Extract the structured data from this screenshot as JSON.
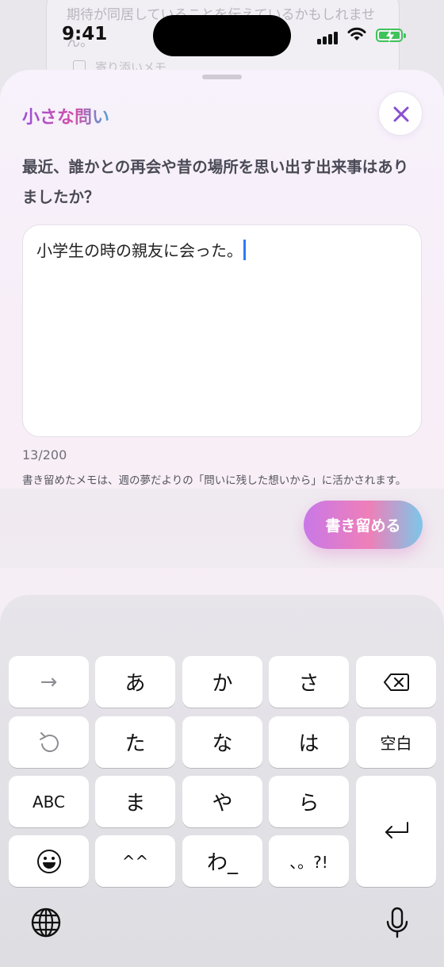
{
  "background": {
    "text": "期待が同居していることを伝えているかもしれません。",
    "memo_label": "寄り添いメモ"
  },
  "status_bar": {
    "time": "9:41",
    "battery_level": 1.0
  },
  "sheet": {
    "title": "小さな問い",
    "question": "最近、誰かとの再会や昔の場所を思い出す出来事はありましたか？",
    "answer_value": "小学生の時の親友に会った。",
    "char_count": "13/200",
    "note": "書き留めたメモは、週の夢だよりの「問いに残した想いから」に活かされます。",
    "save_label": "書き留める"
  },
  "keyboard": {
    "row1": [
      "→",
      "あ",
      "か",
      "さ",
      "delete-icon"
    ],
    "row2": [
      "undo-icon",
      "た",
      "な",
      "は",
      "空白"
    ],
    "row3": [
      "ABC",
      "ま",
      "や",
      "ら"
    ],
    "row4": [
      "emoji-icon",
      "^^",
      "わ_",
      "、。?!"
    ],
    "return_key": "return-icon",
    "bottom": [
      "globe-icon",
      "microphone-icon"
    ]
  },
  "colors": {
    "accent_purple": "#9b4fd6",
    "accent_pink": "#ef7fb8",
    "accent_blue": "#7cc7e8",
    "caret": "#2e7cf6",
    "battery": "#3ec35a"
  }
}
